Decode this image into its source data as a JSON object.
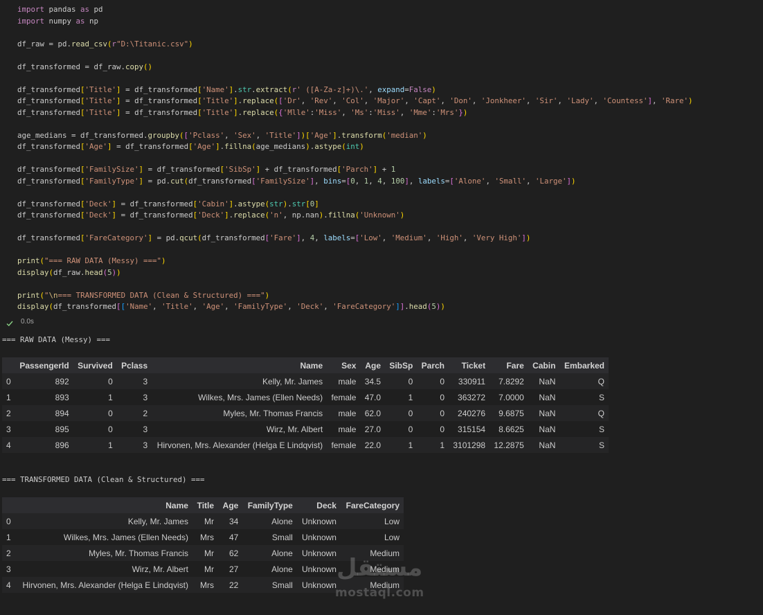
{
  "code_lines": [
    "import pandas as pd",
    "import numpy as np",
    "",
    "df_raw = pd.read_csv(r\"D:\\Titanic.csv\")",
    "",
    "df_transformed = df_raw.copy()",
    "",
    "df_transformed['Title'] = df_transformed['Name'].str.extract(r' ([A-Za-z]+)\\.', expand=False)",
    "df_transformed['Title'] = df_transformed['Title'].replace(['Dr', 'Rev', 'Col', 'Major', 'Capt', 'Don', 'Jonkheer', 'Sir', 'Lady', 'Countess'], 'Rare')",
    "df_transformed['Title'] = df_transformed['Title'].replace({'Mlle':'Miss', 'Ms':'Miss', 'Mme':'Mrs'})",
    "",
    "age_medians = df_transformed.groupby(['Pclass', 'Sex', 'Title'])['Age'].transform('median')",
    "df_transformed['Age'] = df_transformed['Age'].fillna(age_medians).astype(int)",
    "",
    "df_transformed['FamilySize'] = df_transformed['SibSp'] + df_transformed['Parch'] + 1",
    "df_transformed['FamilyType'] = pd.cut(df_transformed['FamilySize'], bins=[0, 1, 4, 100], labels=['Alone', 'Small', 'Large'])",
    "",
    "df_transformed['Deck'] = df_transformed['Cabin'].astype(str).str[0]",
    "df_transformed['Deck'] = df_transformed['Deck'].replace('n', np.nan).fillna('Unknown')",
    "",
    "df_transformed['FareCategory'] = pd.qcut(df_transformed['Fare'], 4, labels=['Low', 'Medium', 'High', 'Very High'])",
    "",
    "print(\"=== RAW DATA (Messy) ===\")",
    "display(df_raw.head(5))",
    "",
    "print(\"\\n=== TRANSFORMED DATA (Clean & Structured) ===\")",
    "display(df_transformed[['Name', 'Title', 'Age', 'FamilyType', 'Deck', 'FareCategory']].head(5))"
  ],
  "execution": {
    "status_icon": "check-icon",
    "time": "0.0s"
  },
  "raw_output": {
    "heading": "=== RAW DATA (Messy) ===",
    "columns": [
      "",
      "PassengerId",
      "Survived",
      "Pclass",
      "Name",
      "Sex",
      "Age",
      "SibSp",
      "Parch",
      "Ticket",
      "Fare",
      "Cabin",
      "Embarked"
    ],
    "rows": [
      [
        "0",
        "892",
        "0",
        "3",
        "Kelly, Mr. James",
        "male",
        "34.5",
        "0",
        "0",
        "330911",
        "7.8292",
        "NaN",
        "Q"
      ],
      [
        "1",
        "893",
        "1",
        "3",
        "Wilkes, Mrs. James (Ellen Needs)",
        "female",
        "47.0",
        "1",
        "0",
        "363272",
        "7.0000",
        "NaN",
        "S"
      ],
      [
        "2",
        "894",
        "0",
        "2",
        "Myles, Mr. Thomas Francis",
        "male",
        "62.0",
        "0",
        "0",
        "240276",
        "9.6875",
        "NaN",
        "Q"
      ],
      [
        "3",
        "895",
        "0",
        "3",
        "Wirz, Mr. Albert",
        "male",
        "27.0",
        "0",
        "0",
        "315154",
        "8.6625",
        "NaN",
        "S"
      ],
      [
        "4",
        "896",
        "1",
        "3",
        "Hirvonen, Mrs. Alexander (Helga E Lindqvist)",
        "female",
        "22.0",
        "1",
        "1",
        "3101298",
        "12.2875",
        "NaN",
        "S"
      ]
    ]
  },
  "transformed_output": {
    "heading": "=== TRANSFORMED DATA (Clean & Structured) ===",
    "columns": [
      "",
      "Name",
      "Title",
      "Age",
      "FamilyType",
      "Deck",
      "FareCategory"
    ],
    "rows": [
      [
        "0",
        "Kelly, Mr. James",
        "Mr",
        "34",
        "Alone",
        "Unknown",
        "Low"
      ],
      [
        "1",
        "Wilkes, Mrs. James (Ellen Needs)",
        "Mrs",
        "47",
        "Small",
        "Unknown",
        "Low"
      ],
      [
        "2",
        "Myles, Mr. Thomas Francis",
        "Mr",
        "62",
        "Alone",
        "Unknown",
        "Medium"
      ],
      [
        "3",
        "Wirz, Mr. Albert",
        "Mr",
        "27",
        "Alone",
        "Unknown",
        "Medium"
      ],
      [
        "4",
        "Hirvonen, Mrs. Alexander (Helga E Lindqvist)",
        "Mrs",
        "22",
        "Small",
        "Unknown",
        "Medium"
      ]
    ]
  },
  "watermark": {
    "arabic": "مستقل",
    "latin": "mostaql.com"
  },
  "colors": {
    "background": "#1f1f1f",
    "keyword": "#c586c0",
    "function": "#dcdcaa",
    "string": "#ce9178",
    "number": "#b5cea8",
    "bracket": "#ffd700",
    "check": "#89d185"
  }
}
